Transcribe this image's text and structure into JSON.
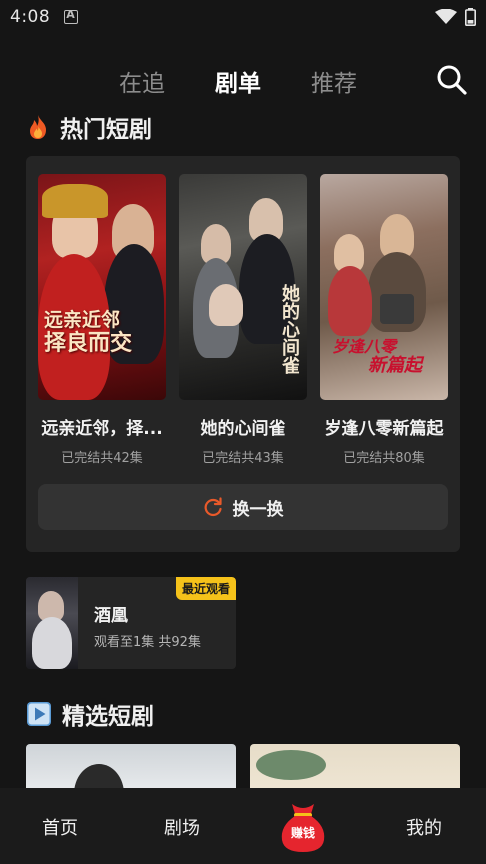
{
  "status_bar": {
    "time": "4:08"
  },
  "top_tabs": [
    {
      "label": "在追",
      "active": false
    },
    {
      "label": "剧单",
      "active": true
    },
    {
      "label": "推荐",
      "active": false
    }
  ],
  "hot_section": {
    "title": "热门短剧",
    "cards": [
      {
        "title": "远亲近邻，择...",
        "status": "已完结共42集",
        "poster_text": [
          "远亲近邻",
          "择良而交"
        ]
      },
      {
        "title": "她的心间雀",
        "status": "已完结共43集",
        "poster_text": [
          "她的心间雀"
        ]
      },
      {
        "title": "岁逢八零新篇起",
        "status": "已完结共80集",
        "poster_text": [
          "岁逢八零",
          "新篇起"
        ]
      }
    ],
    "refresh_label": "换一换"
  },
  "recent_watch": {
    "badge": "最近观看",
    "title": "酒凰",
    "progress": "观看至1集 共92集"
  },
  "featured_section": {
    "title": "精选短剧"
  },
  "bottom_nav": {
    "home": "首页",
    "theater": "剧场",
    "earn": "赚钱",
    "mine": "我的"
  },
  "colors": {
    "background": "#151515",
    "panel": "#252525",
    "accent_orange": "#e8592a",
    "badge_yellow": "#f5c21a",
    "earn_red": "#e5252e"
  }
}
